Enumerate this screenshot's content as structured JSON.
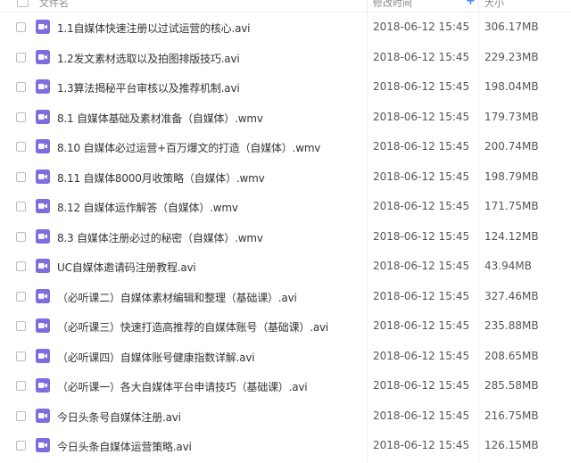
{
  "header": {
    "name_label": "文件名",
    "date_label": "修改时间",
    "size_label": "大小",
    "add_glyph": "+"
  },
  "colors": {
    "video_icon": "#7b6fe0",
    "accent": "#3b8cff"
  },
  "files": [
    {
      "icon": "video-icon",
      "name": "1.1自媒体快速注册以过试运营的核心.avi",
      "date": "2018-06-12 15:45",
      "size": "306.17MB"
    },
    {
      "icon": "video-icon",
      "name": "1.2发文素材选取以及拍图排版技巧.avi",
      "date": "2018-06-12 15:45",
      "size": "229.23MB"
    },
    {
      "icon": "video-icon",
      "name": "1.3算法揭秘平台审核以及推荐机制.avi",
      "date": "2018-06-12 15:45",
      "size": "198.04MB"
    },
    {
      "icon": "video-icon",
      "name": "8.1 自媒体基础及素材准备（自媒体）.wmv",
      "date": "2018-06-12 15:45",
      "size": "179.73MB"
    },
    {
      "icon": "video-icon",
      "name": "8.10 自媒体必过运营+百万爆文的打造（自媒体）.wmv",
      "date": "2018-06-12 15:45",
      "size": "200.74MB"
    },
    {
      "icon": "video-icon",
      "name": "8.11 自媒体8000月收策略（自媒体）.wmv",
      "date": "2018-06-12 15:45",
      "size": "198.79MB"
    },
    {
      "icon": "video-icon",
      "name": "8.12 自媒体运作解答（自媒体）.wmv",
      "date": "2018-06-12 15:45",
      "size": "171.75MB"
    },
    {
      "icon": "video-icon",
      "name": "8.3 自媒体注册必过的秘密（自媒体）.wmv",
      "date": "2018-06-12 15:45",
      "size": "124.12MB"
    },
    {
      "icon": "video-icon",
      "name": "UC自媒体邀请码注册教程.avi",
      "date": "2018-06-12 15:45",
      "size": "43.94MB"
    },
    {
      "icon": "video-icon",
      "name": "（必听课二）自媒体素材编辑和整理（基础课）.avi",
      "date": "2018-06-12 15:45",
      "size": "327.46MB"
    },
    {
      "icon": "video-icon",
      "name": "（必听课三）快速打造高推荐的自媒体账号（基础课）.avi",
      "date": "2018-06-12 15:45",
      "size": "235.88MB"
    },
    {
      "icon": "video-icon",
      "name": "（必听课四）自媒体账号健康指数详解.avi",
      "date": "2018-06-12 15:45",
      "size": "208.65MB"
    },
    {
      "icon": "video-icon",
      "name": "（必听课一）各大自媒体平台申请技巧（基础课）.avi",
      "date": "2018-06-12 15:45",
      "size": "285.58MB"
    },
    {
      "icon": "video-icon",
      "name": "今日头条号自媒体注册.avi",
      "date": "2018-06-12 15:45",
      "size": "216.75MB"
    },
    {
      "icon": "video-icon",
      "name": "今日头条自媒体运营策略.avi",
      "date": "2018-06-12 15:45",
      "size": "126.15MB"
    }
  ]
}
